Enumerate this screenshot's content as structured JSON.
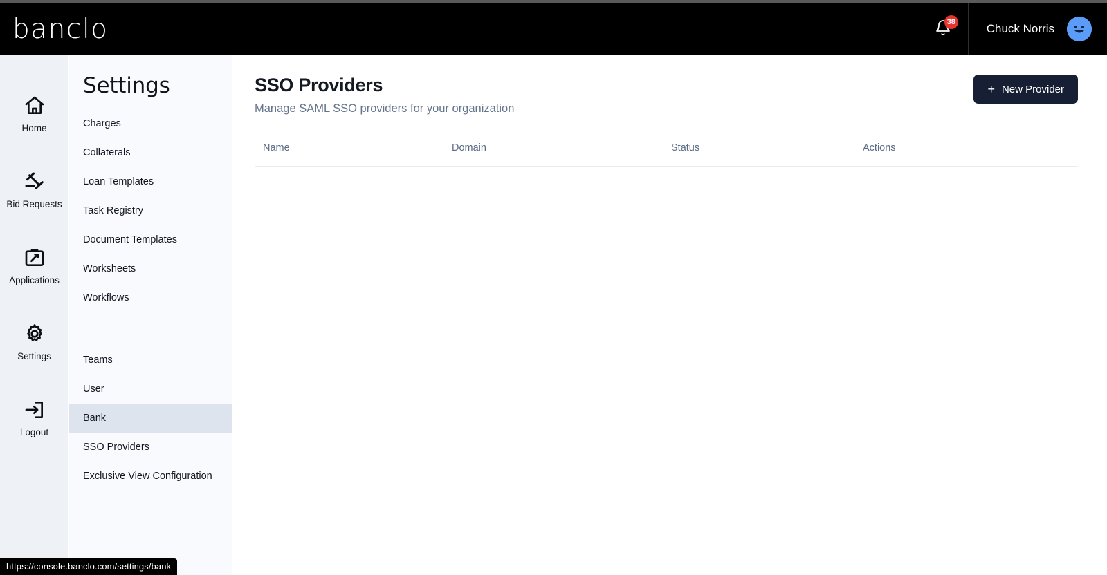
{
  "topbar": {
    "logo": "banclo",
    "notification_icon": "bell-icon",
    "notification_count": "38",
    "user_name": "Chuck Norris",
    "avatar_icon": "smiley-avatar",
    "badge_color": "#e8332f",
    "avatar_color": "#5b9cf8",
    "background": "#000000"
  },
  "rail": {
    "items": [
      {
        "label": "Home",
        "icon": "home-icon"
      },
      {
        "label": "Bid Requests",
        "icon": "gavel-icon"
      },
      {
        "label": "Applications",
        "icon": "clipboard-pencil-icon"
      },
      {
        "label": "Settings",
        "icon": "gear-icon"
      },
      {
        "label": "Logout",
        "icon": "logout-arrow-icon"
      }
    ]
  },
  "submenu": {
    "title": "Settings",
    "group_one": [
      {
        "label": "Charges"
      },
      {
        "label": "Collaterals"
      },
      {
        "label": "Loan Templates"
      },
      {
        "label": "Task Registry"
      },
      {
        "label": "Document Templates"
      },
      {
        "label": "Worksheets"
      },
      {
        "label": "Workflows"
      }
    ],
    "group_two": [
      {
        "label": "Teams"
      },
      {
        "label": "User"
      },
      {
        "label": "Bank"
      },
      {
        "label": "SSO Providers"
      },
      {
        "label": "Exclusive View Configuration"
      }
    ],
    "active_label": "Bank",
    "active_background": "#dde4ee"
  },
  "main": {
    "title": "SSO Providers",
    "subtitle": "Manage SAML SSO providers for your organization",
    "new_provider_button": "New Provider",
    "new_provider_plus": "+",
    "button_color": "#161f33",
    "table": {
      "columns": [
        "Name",
        "Domain",
        "Status",
        "Actions"
      ],
      "rows": []
    }
  },
  "status_bar": {
    "url": "https://console.banclo.com/settings/bank"
  }
}
